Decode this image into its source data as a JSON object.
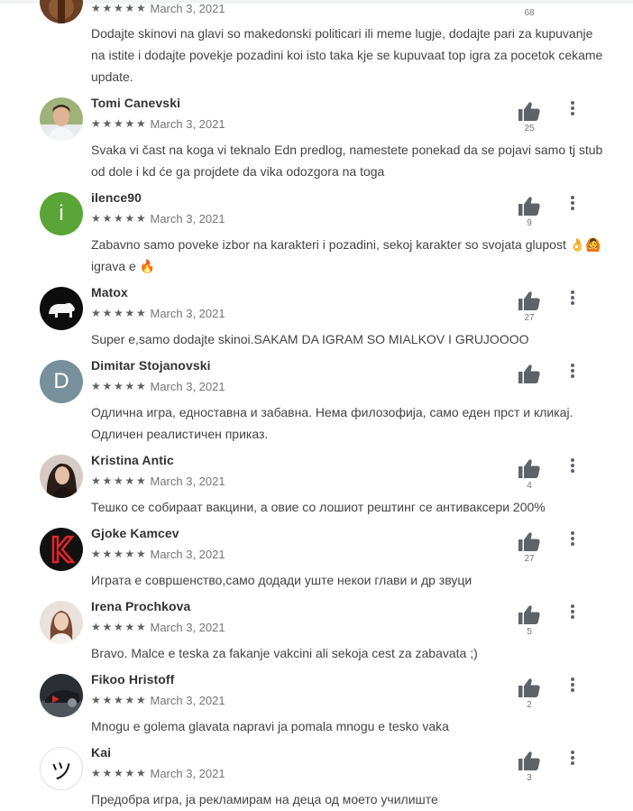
{
  "reviews": [
    {
      "name": "",
      "stars": 5,
      "date": "March 3, 2021",
      "likes": "68",
      "avatar": "photo-brown",
      "text": "Dodajte skinovi na glavi so makedonski politicari ili meme lugje, dodajte pari za kupuvanje na istite i dodajte povekje pozadini koi isto taka kje se kupuvaat top igra za pocetok cekame update."
    },
    {
      "name": "Tomi Canevski",
      "stars": 5,
      "date": "March 3, 2021",
      "likes": "25",
      "avatar": "photo-man",
      "text": "Svaka vi čast na koga vi teknalo Edn predlog, namestete ponekad da se pojavi samo tj stub od dole i kd će ga projdete da vika odozgora na toga"
    },
    {
      "name": "ilence90",
      "stars": 5,
      "date": "March 3, 2021",
      "likes": "9",
      "avatar": "letter",
      "avatar_letter": "i",
      "avatar_color": "#5aa537",
      "text": "Zabavno samo poveke izbor na karakteri i pozadini, sekoj karakter so svojata glupost 👌🙆 igrava e 🔥"
    },
    {
      "name": "Matox",
      "stars": 5,
      "date": "March 3, 2021",
      "likes": "27",
      "avatar": "bear",
      "text": "Super e,samo dodajte skinoi.SAKAM DA IGRAM SO MIALKOV I GRUJOOOO"
    },
    {
      "name": "Dimitar Stojanovski",
      "stars": 5,
      "date": "March 3, 2021",
      "likes": "",
      "avatar": "letter",
      "avatar_letter": "D",
      "avatar_color": "#78909c",
      "text": "Одлична игра, едноставна и забавна. Нема филозофија, само еден прст и кликај. Одличен реалистичен приказ."
    },
    {
      "name": "Kristina Antic",
      "stars": 5,
      "date": "March 3, 2021",
      "likes": "4",
      "avatar": "photo-woman-dark",
      "text": "Тешко се собираат вакцини, а овие со лошиот рештинг се антиваксери 200%"
    },
    {
      "name": "Gjoke Kamcev",
      "stars": 5,
      "date": "March 3, 2021",
      "likes": "27",
      "avatar": "logo-k",
      "text": "Играта е совршенство,само додади уште некои глави и др звуци"
    },
    {
      "name": "Irena Prochkova",
      "stars": 5,
      "date": "March 3, 2021",
      "likes": "5",
      "avatar": "photo-woman-light",
      "text": "Bravo. Malce e teska za fakanje vakcini ali sekoja cest za zabavata ;)"
    },
    {
      "name": "Fikoo Hristoff",
      "stars": 5,
      "date": "March 3, 2021",
      "likes": "2",
      "avatar": "car",
      "text": "Mnogu e golema glavata napravi ja pomala mnogu e tesko vaka"
    },
    {
      "name": "Kai",
      "stars": 5,
      "date": "March 3, 2021",
      "likes": "3",
      "avatar": "letter",
      "avatar_letter": "ツ",
      "avatar_color": "#ffffff",
      "avatar_text_color": "#111111",
      "text": "Предобра игра, ја рекламирам на деца од моето училиште"
    }
  ],
  "icons": {
    "star": "star-icon",
    "thumb": "thumbs-up-icon",
    "more": "more-vert-icon"
  },
  "colors": {
    "star": "#616161",
    "icon": "#5f6368",
    "name": "#333333",
    "body_text": "#444444",
    "meta": "#757575"
  }
}
